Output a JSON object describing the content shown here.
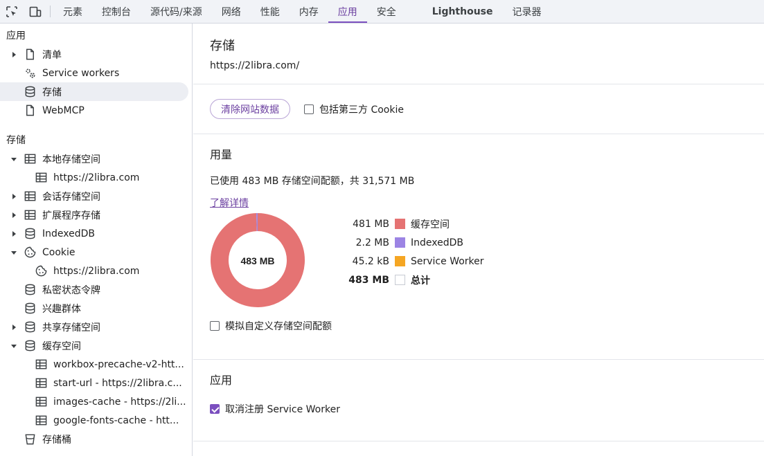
{
  "toolbar": {
    "tabs": [
      "元素",
      "控制台",
      "源代码/来源",
      "网络",
      "性能",
      "内存",
      "应用",
      "安全",
      "Lighthouse",
      "记录器"
    ]
  },
  "sidebar": {
    "section_app": "应用",
    "app_items": [
      "清单",
      "Service workers",
      "存储",
      "WebMCP"
    ],
    "section_storage": "存储",
    "local_storage": "本地存储空间",
    "local_child": "https://2libra.com",
    "session_storage": "会话存储空间",
    "extension_storage": "扩展程序存储",
    "indexeddb": "IndexedDB",
    "cookie": "Cookie",
    "cookie_child": "https://2libra.com",
    "private_state": "私密状态令牌",
    "interest_groups": "兴趣群体",
    "shared_storage": "共享存储空间",
    "cache_storage": "缓存空间",
    "cache_children": [
      "workbox-precache-v2-htt...",
      "start-url - https://2libra.c...",
      "images-cache - https://2li...",
      "google-fonts-cache - htt..."
    ],
    "buckets": "存储桶"
  },
  "main": {
    "title": "存储",
    "origin": "https://2libra.com/",
    "clear_button": "清除网站数据",
    "include_third_party": "包括第三方 Cookie",
    "usage_title": "用量",
    "usage_text": "已使用 483 MB 存储空间配额，共 31,571 MB",
    "learn_more": "了解详情",
    "simulate_quota": "模拟自定义存储空间配额",
    "app_title": "应用",
    "unregister_sw": "取消注册 Service Worker",
    "storage_title": "存储"
  },
  "chart_data": {
    "type": "pie",
    "center_label": "483 MB",
    "categories": [
      "缓存空间",
      "IndexedDB",
      "Service Worker"
    ],
    "values": [
      481,
      2.2,
      0.0452
    ],
    "value_labels": [
      "481 MB",
      "2.2 MB",
      "45.2 kB"
    ],
    "colors": [
      "#e57373",
      "#9c84e4",
      "#f5a623"
    ],
    "total_label": "总计",
    "total_value": "483 MB",
    "total_color": "#ffffff"
  }
}
